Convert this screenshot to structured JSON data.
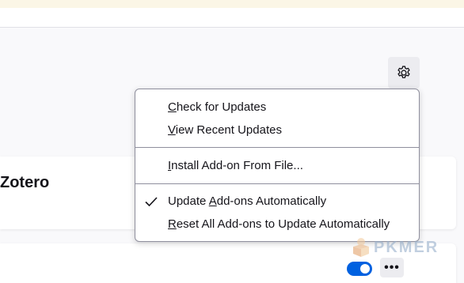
{
  "card": {
    "title": "Zotero"
  },
  "menu": {
    "items": [
      {
        "accesskey": "C",
        "rest": "heck for Updates",
        "pre": ""
      },
      {
        "accesskey": "V",
        "rest": "iew Recent Updates",
        "pre": ""
      },
      {
        "accesskey": "I",
        "rest": "nstall Add-on From File...",
        "pre": ""
      },
      {
        "accesskey": "A",
        "rest": "dd-ons Automatically",
        "pre": "Update ",
        "checked": true
      },
      {
        "accesskey": "R",
        "rest": "eset All Add-ons to Update Automatically",
        "pre": ""
      }
    ]
  },
  "toggle": {
    "enabled": true
  },
  "more_button": {
    "label": "•••"
  },
  "watermark": {
    "text": "PKMER"
  },
  "colors": {
    "accent": "#0061e0",
    "banner": "#fbf6e6"
  }
}
